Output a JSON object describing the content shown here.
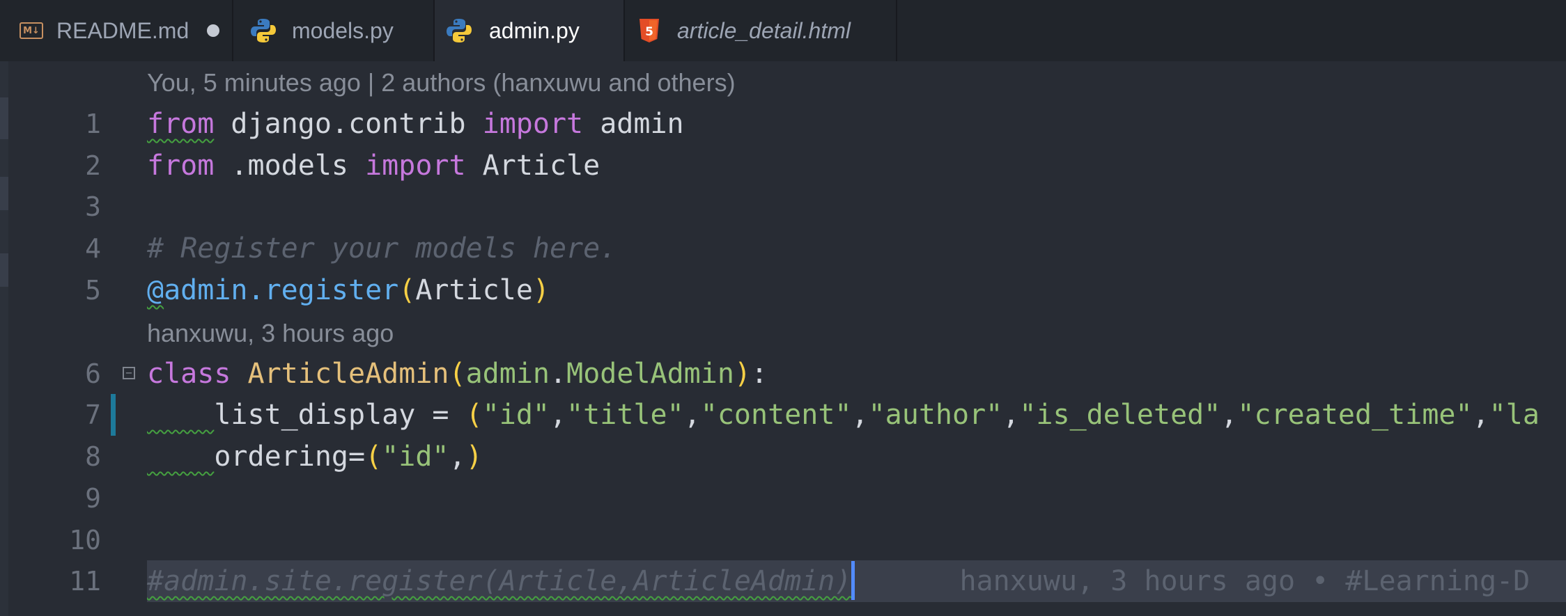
{
  "tabs": [
    {
      "label": "README.md",
      "icon": "markdown-icon",
      "dirty": true,
      "italic": false,
      "active": false
    },
    {
      "label": "models.py",
      "icon": "python-icon",
      "dirty": false,
      "italic": false,
      "active": false
    },
    {
      "label": "admin.py",
      "icon": "python-icon",
      "dirty": false,
      "italic": false,
      "active": true
    },
    {
      "label": "article_detail.html",
      "icon": "html5-icon",
      "dirty": false,
      "italic": true,
      "active": false
    }
  ],
  "markdown_badge": "M↓",
  "html5_badge": "5",
  "codelens": {
    "top": "You, 5 minutes ago | 2 authors (hanxuwu and others)",
    "before_class": "hanxuwu, 3 hours ago"
  },
  "line_numbers": [
    "1",
    "2",
    "3",
    "4",
    "5",
    "6",
    "7",
    "8",
    "9",
    "10",
    "11"
  ],
  "code": {
    "l1": {
      "kw1": "from",
      "mod": " django.contrib ",
      "kw2": "import",
      "name": " admin"
    },
    "l2": {
      "kw1": "from",
      "mod": " .models ",
      "kw2": "import",
      "name": " Article"
    },
    "l4": {
      "comment": "# Register your models here."
    },
    "l5": {
      "at": "@",
      "deco": "admin.register",
      "open": "(",
      "arg": "Article",
      "close": ")"
    },
    "l6": {
      "kw": "class",
      "space": " ",
      "cls": "ArticleAdmin",
      "open": "(",
      "base1": "admin",
      "dot": ".",
      "base2": "ModelAdmin",
      "close": ")",
      "colon": ":"
    },
    "l7": {
      "indent": "    ",
      "name": "list_display = ",
      "open": "(",
      "items": [
        "\"id\"",
        ",",
        "\"title\"",
        ",",
        "\"content\"",
        ",",
        "\"author\"",
        ",",
        "\"is_deleted\"",
        ",",
        "\"created_time\"",
        ",",
        "\"la"
      ]
    },
    "l8": {
      "indent": "    ",
      "name": "ordering=",
      "open": "(",
      "str": "\"id\"",
      "comma": ",",
      "close": ")"
    },
    "l11": {
      "comment": "#admin.site.register(Article,ArticleAdmin)",
      "blame": "hanxuwu, 3 hours ago • #Learning-D"
    }
  },
  "colors": {
    "keyword": "#c678dd",
    "function": "#61afef",
    "class": "#e5c07b",
    "string": "#98c379",
    "comment": "#5c6370",
    "bracket": "#f7d046",
    "background": "#282c34",
    "tabbar": "#21252b"
  }
}
